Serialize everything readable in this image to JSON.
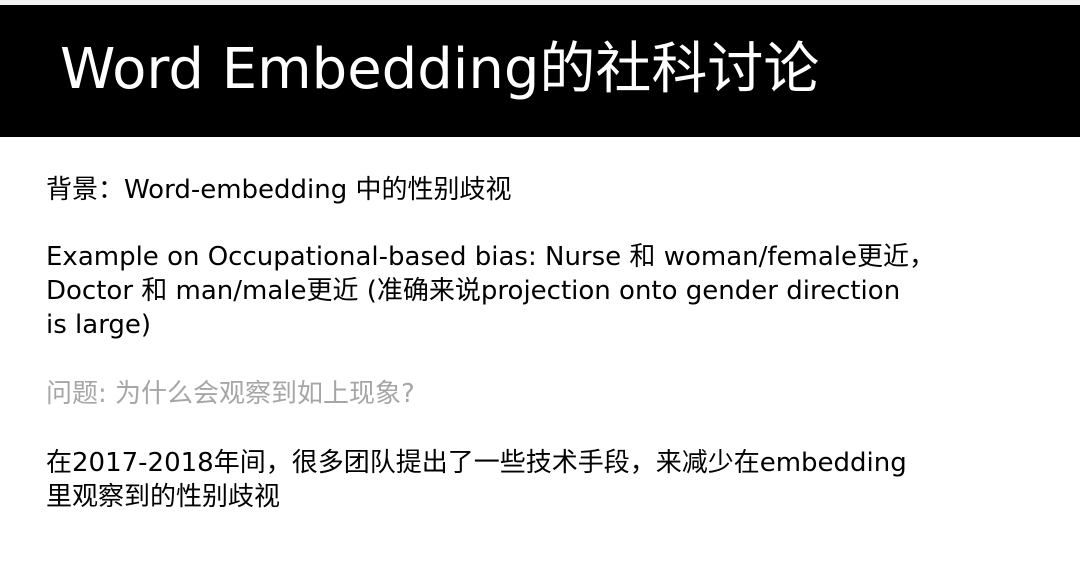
{
  "slide": {
    "title": "Word Embedding的社科讨论",
    "background_line": "背景：Word-embedding 中的性别歧视",
    "example_lines": [
      "Example on Occupational-based bias: Nurse 和 woman/female更近，",
      "Doctor 和 man/male更近 (准确来说projection onto gender direction",
      "is large)"
    ],
    "question_line": "问题: 为什么会观察到如上现象?",
    "answer_lines": [
      "在2017-2018年间，很多团队提出了一些技术手段，来减少在embedding",
      "里观察到的性别歧视"
    ]
  },
  "colors": {
    "title_bar": "#000000",
    "title_text": "#ffffff",
    "body_text": "#000000",
    "question_text": "#a6a6a6"
  }
}
